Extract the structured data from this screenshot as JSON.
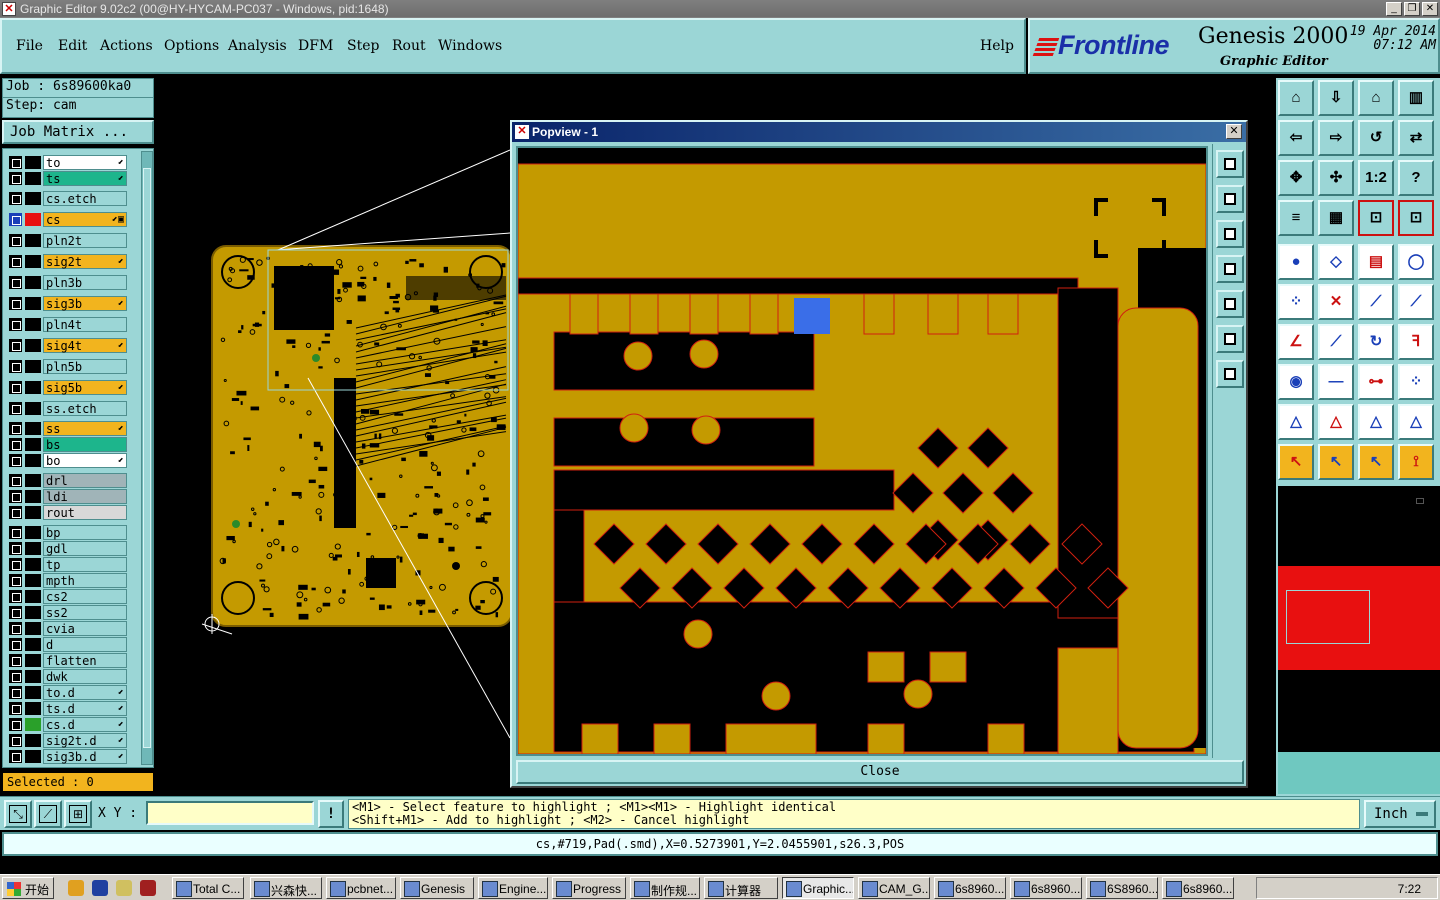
{
  "window": {
    "title": "Graphic Editor 9.02c2 (00@HY-HYCAM-PC037 - Windows, pid:1648)",
    "controls": [
      "_",
      "❐",
      "✕"
    ]
  },
  "menu": [
    "File",
    "Edit",
    "Actions",
    "Options",
    "Analysis",
    "DFM",
    "Step",
    "Rout",
    "Windows"
  ],
  "help": "Help",
  "brand": {
    "logo": "Frontline",
    "product": "Genesis 2000",
    "subtitle": "Graphic Editor",
    "date": "19 Apr 2014",
    "time": "07:12 AM"
  },
  "job": {
    "job_line": "Job : 6s89600ka0",
    "step_line": "Step: cam",
    "matrix_button": "Job Matrix ..."
  },
  "layers": [
    {
      "name": "to",
      "bg": "#ffffff",
      "mark": "⬋"
    },
    {
      "name": "ts",
      "bg": "#1db58c",
      "mark": "⬋"
    },
    {
      "name": "cs.etch",
      "bg": "#9bd6d6",
      "mark": ""
    },
    {
      "name": "cs",
      "bg": "#f2b41e",
      "mark": "⬋▣",
      "active": true
    },
    {
      "name": "pln2t",
      "bg": "#9bd6d6",
      "mark": ""
    },
    {
      "name": "sig2t",
      "bg": "#f2b41e",
      "mark": "⬋"
    },
    {
      "name": "pln3b",
      "bg": "#9bd6d6",
      "mark": ""
    },
    {
      "name": "sig3b",
      "bg": "#f2b41e",
      "mark": "⬋"
    },
    {
      "name": "pln4t",
      "bg": "#9bd6d6",
      "mark": ""
    },
    {
      "name": "sig4t",
      "bg": "#f2b41e",
      "mark": "⬋"
    },
    {
      "name": "pln5b",
      "bg": "#9bd6d6",
      "mark": ""
    },
    {
      "name": "sig5b",
      "bg": "#f2b41e",
      "mark": "⬋"
    },
    {
      "name": "ss.etch",
      "bg": "#9bd6d6",
      "mark": ""
    },
    {
      "name": "ss",
      "bg": "#f2b41e",
      "mark": "⬋"
    },
    {
      "name": "bs",
      "bg": "#1db58c",
      "mark": ""
    },
    {
      "name": "bo",
      "bg": "#ffffff",
      "mark": "⬋"
    },
    {
      "name": "drl",
      "bg": "#a0b4b8",
      "mark": ""
    },
    {
      "name": "ldi",
      "bg": "#a0b4b8",
      "mark": ""
    },
    {
      "name": "rout",
      "bg": "#d8d8d8",
      "mark": ""
    },
    {
      "name": "bp",
      "bg": "#9bd6d6",
      "mark": ""
    },
    {
      "name": "gdl",
      "bg": "#9bd6d6",
      "mark": ""
    },
    {
      "name": "tp",
      "bg": "#9bd6d6",
      "mark": ""
    },
    {
      "name": "mpth",
      "bg": "#9bd6d6",
      "mark": ""
    },
    {
      "name": "cs2",
      "bg": "#9bd6d6",
      "mark": ""
    },
    {
      "name": "ss2",
      "bg": "#9bd6d6",
      "mark": ""
    },
    {
      "name": "cvia",
      "bg": "#9bd6d6",
      "mark": ""
    },
    {
      "name": "d",
      "bg": "#9bd6d6",
      "mark": ""
    },
    {
      "name": "flatten",
      "bg": "#9bd6d6",
      "mark": ""
    },
    {
      "name": "dwk",
      "bg": "#9bd6d6",
      "mark": ""
    },
    {
      "name": "to.d",
      "bg": "#9bd6d6",
      "mark": "⬋"
    },
    {
      "name": "ts.d",
      "bg": "#9bd6d6",
      "mark": "⬋"
    },
    {
      "name": "cs.d",
      "bg": "#9bd6d6",
      "mark": "⬋",
      "swatch": "#2aa02a"
    },
    {
      "name": "sig2t.d",
      "bg": "#9bd6d6",
      "mark": "⬋"
    },
    {
      "name": "sig3b.d",
      "bg": "#9bd6d6",
      "mark": "⬋"
    }
  ],
  "selected": "Selected : 0",
  "popview": {
    "title": "Popview - 1",
    "close": "Close",
    "pcb_colors": {
      "copper": "#c49a00",
      "substrate": "#000000",
      "edge": "#d02010",
      "highlight": "#3a6ee8"
    }
  },
  "right_tools": [
    "home-icon",
    "down-icon",
    "house-icon",
    "split-icon",
    "left-icon",
    "right-icon",
    "undo-zoom-icon",
    "redo-icon",
    "fit-icon",
    "pan-icon",
    "one-to-two-icon",
    "help-icon",
    "measure-icon",
    "grid-icon",
    "snap-icon",
    "snap-center-icon",
    "feature-icon",
    "shape-icon",
    "ruler-icon",
    "pad-icon",
    "net-icon",
    "cross-icon",
    "line-icon",
    "line2-icon",
    "angle-icon",
    "slash-icon",
    "arc-icon",
    "ff-icon",
    "surface-icon",
    "minus-icon",
    "dim-icon",
    "circles-icon",
    "polygon-icon",
    "triangle-icon",
    "triangle2-icon",
    "triangle3-icon",
    "pointer-icon",
    "pointer2-icon",
    "pointer3-icon",
    "flow-icon"
  ],
  "bottom": {
    "xy_label": "X Y :",
    "xy_value": "",
    "excl": "!",
    "hint1": "<M1> - Select feature to highlight ; <M1><M1> - Highlight identical",
    "hint2": "<Shift+M1> - Add to highlight ; <M2> - Cancel highlight",
    "units": "Inch",
    "status": "cs,#719,Pad(.smd),X=0.5273901,Y=2.0455901,s26.3,POS"
  },
  "taskbar": {
    "start": "开始",
    "tasks": [
      "Total C...",
      "兴森快...",
      "pcbnet...",
      "Genesis",
      "Engine...",
      "Progress",
      "制作规...",
      "计算器",
      "Graphic...",
      "CAM_G...",
      "6s8960...",
      "6s8960...",
      "6S8960...",
      "6s8960..."
    ],
    "clock": "7:22"
  }
}
